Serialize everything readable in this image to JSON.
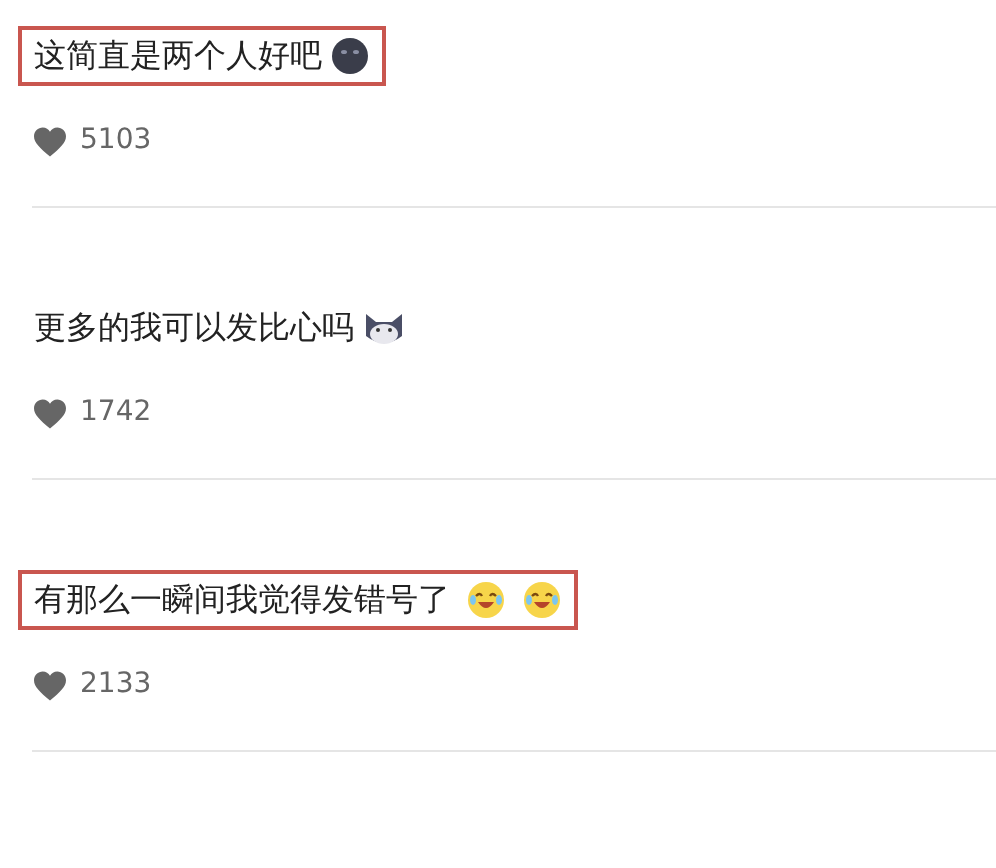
{
  "comments": [
    {
      "text": "这简直是两个人好吧",
      "highlighted": true,
      "emojis": [
        {
          "kind": "dark-blob"
        }
      ],
      "likes": "5103"
    },
    {
      "text": "更多的我可以发比心吗",
      "highlighted": false,
      "emojis": [
        {
          "kind": "cat"
        }
      ],
      "likes": "1742"
    },
    {
      "text": "有那么一瞬间我觉得发错号了",
      "highlighted": true,
      "emojis": [
        {
          "kind": "laugh-cry"
        },
        {
          "kind": "laugh-cry"
        }
      ],
      "likes": "2133"
    }
  ]
}
